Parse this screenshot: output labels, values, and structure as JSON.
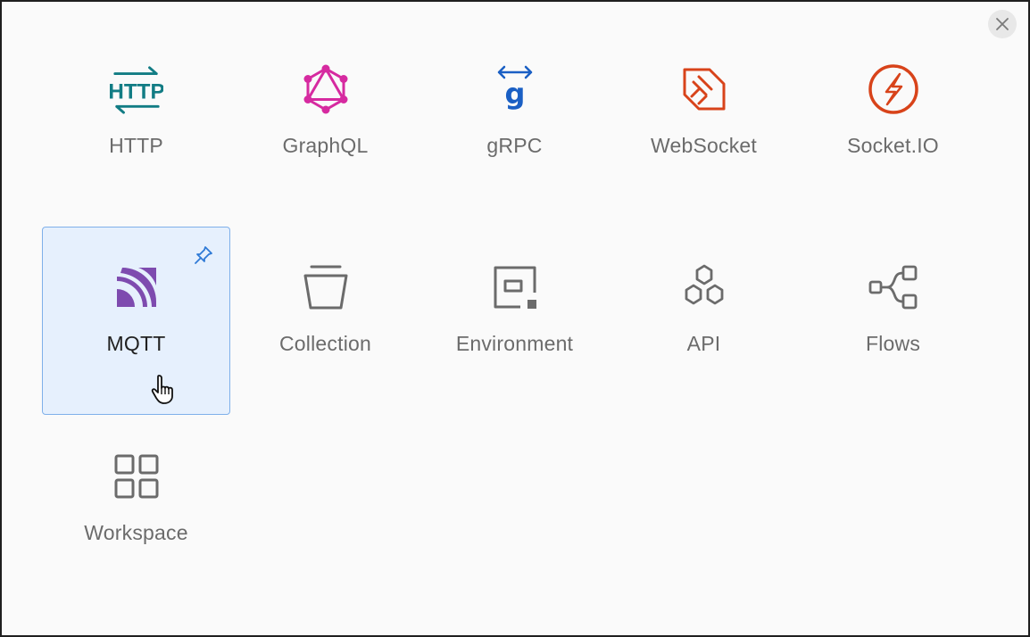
{
  "dialog": {
    "close_icon": "close-icon",
    "items": [
      {
        "id": "http",
        "label": "HTTP",
        "icon": "http-icon",
        "color": "#127c84"
      },
      {
        "id": "graphql",
        "label": "GraphQL",
        "icon": "graphql-icon",
        "color": "#d62aa0"
      },
      {
        "id": "grpc",
        "label": "gRPC",
        "icon": "grpc-icon",
        "color": "#1a5fc4"
      },
      {
        "id": "websocket",
        "label": "WebSocket",
        "icon": "websocket-icon",
        "color": "#d8431a"
      },
      {
        "id": "socketio",
        "label": "Socket.IO",
        "icon": "socketio-icon",
        "color": "#d8431a"
      },
      {
        "id": "mqtt",
        "label": "MQTT",
        "icon": "mqtt-icon",
        "color": "#7e4baf",
        "selected": true,
        "pinned": true
      },
      {
        "id": "collection",
        "label": "Collection",
        "icon": "collection-icon",
        "color": "#6b6b6b"
      },
      {
        "id": "environment",
        "label": "Environment",
        "icon": "environment-icon",
        "color": "#6b6b6b"
      },
      {
        "id": "api",
        "label": "API",
        "icon": "api-icon",
        "color": "#6b6b6b"
      },
      {
        "id": "flows",
        "label": "Flows",
        "icon": "flows-icon",
        "color": "#6b6b6b"
      },
      {
        "id": "workspace",
        "label": "Workspace",
        "icon": "workspace-icon",
        "color": "#6b6b6b"
      }
    ]
  },
  "colors": {
    "selected_bg": "#e6f0fd",
    "selected_border": "#7fb0ea",
    "pin": "#2f7ad6"
  }
}
